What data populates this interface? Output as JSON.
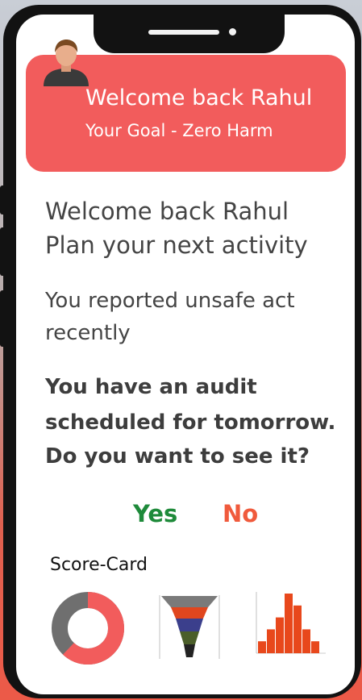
{
  "banner": {
    "title": "Welcome back Rahul",
    "goal": "Your Goal - Zero Harm"
  },
  "greeting": {
    "line1": "Welcome back Rahul",
    "line2": "Plan your next activity"
  },
  "report": {
    "line1": "You reported unsafe act",
    "line2": "recently"
  },
  "audit": {
    "line1": "You have an audit",
    "line2": "scheduled for tomorrow.",
    "line3": "Do you want to see it?"
  },
  "actions": {
    "yes": "Yes",
    "no": "No"
  },
  "scorecard": {
    "label": "Score-Card",
    "donut": {
      "fraction": 0.62,
      "fill_color": "#f25c5c",
      "track_color": "#6f6f6f"
    },
    "funnel": {
      "colors": [
        "#7a7a7a",
        "#e0461e",
        "#3b3f8c",
        "#4b5e2a",
        "#222222"
      ]
    },
    "histogram": {
      "values": [
        2,
        4,
        6,
        10,
        8,
        4,
        2
      ],
      "color": "#e8481c"
    }
  },
  "icons": {
    "avatar": "person-avatar-icon"
  }
}
